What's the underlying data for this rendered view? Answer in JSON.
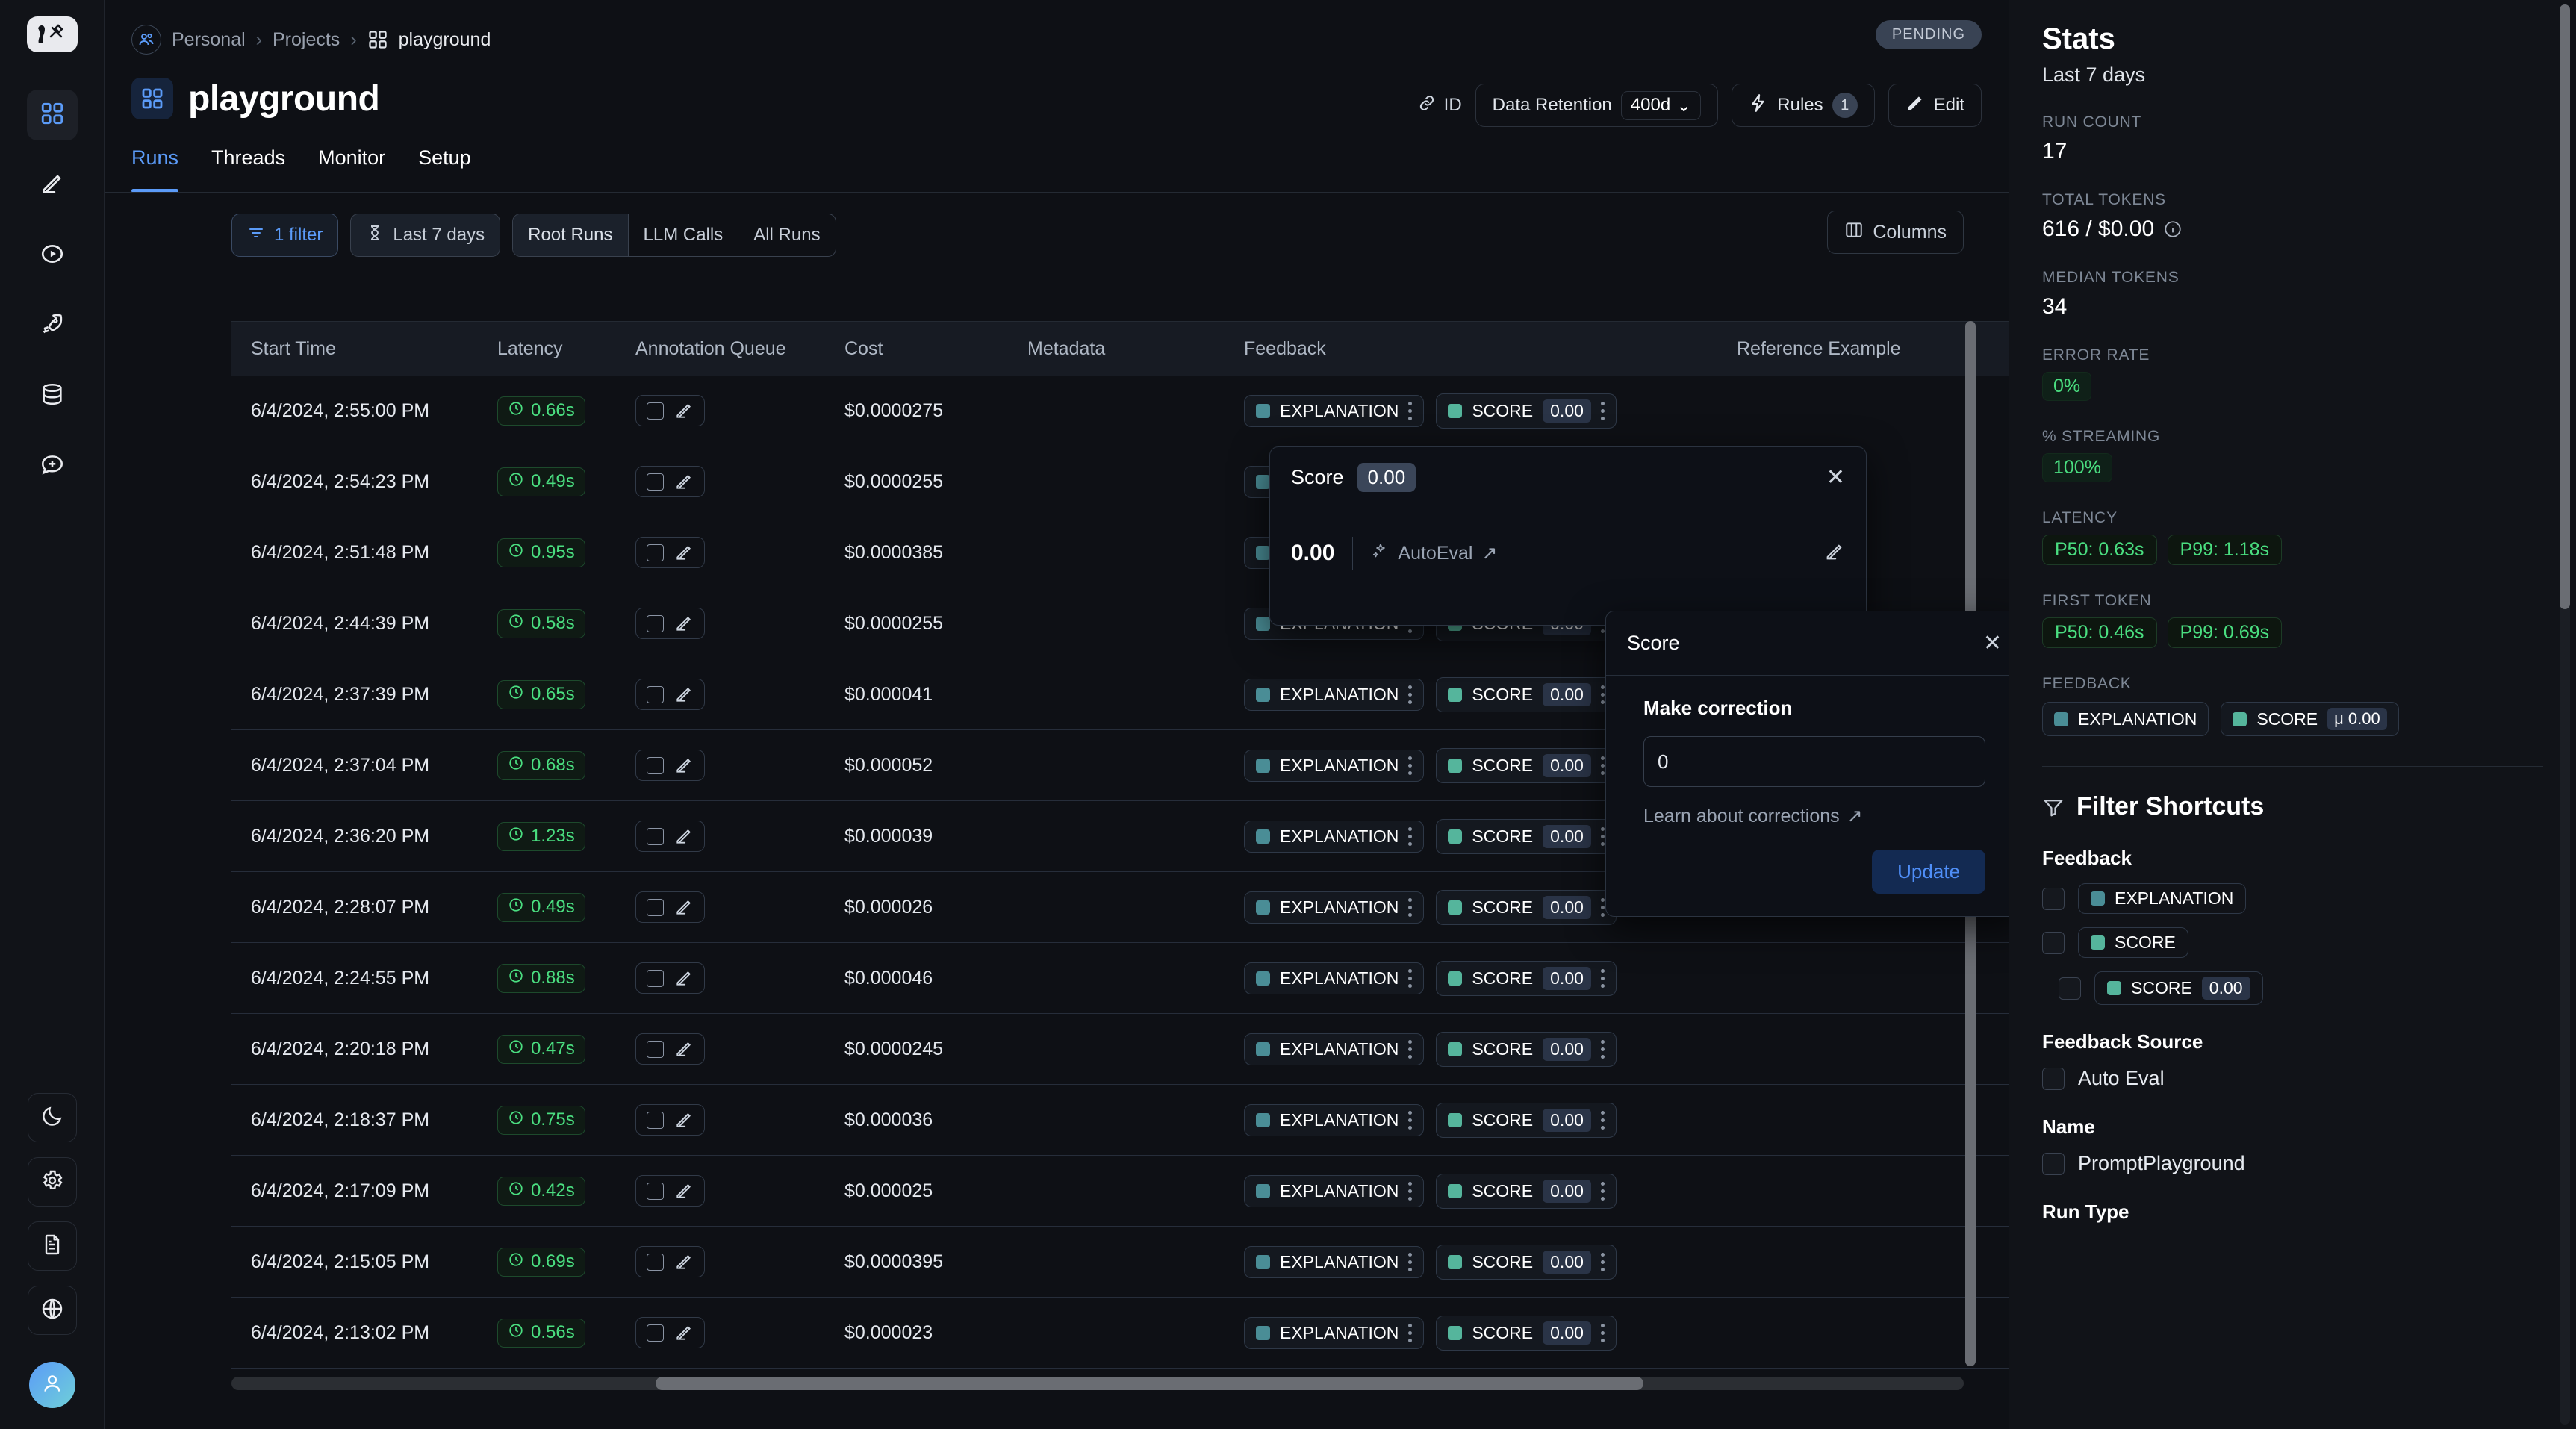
{
  "colors": {
    "accent": "#5b9bf8",
    "green": "#4ade80",
    "teal_explanation": "#4a8d96",
    "teal_score": "#55b59c",
    "panel_bg": "#111318",
    "page_bg": "#0e1015"
  },
  "left_rail": {
    "logo_name": "langsmith-logo",
    "top_items": [
      {
        "icon": "grid-icon",
        "name": "sidebar-item-projects",
        "active": true
      },
      {
        "icon": "pencil-icon",
        "name": "sidebar-item-prompts",
        "active": false
      },
      {
        "icon": "play-circle-icon",
        "name": "sidebar-item-playground",
        "active": false
      },
      {
        "icon": "rocket-icon",
        "name": "sidebar-item-deployments",
        "active": false
      },
      {
        "icon": "database-icon",
        "name": "sidebar-item-datasets",
        "active": false
      },
      {
        "icon": "chat-plus-icon",
        "name": "sidebar-item-annotation",
        "active": false
      }
    ],
    "bottom_items": [
      {
        "icon": "moon-icon",
        "name": "theme-toggle-button"
      },
      {
        "icon": "gear-icon",
        "name": "settings-button"
      },
      {
        "icon": "document-icon",
        "name": "docs-button"
      },
      {
        "icon": "globe-icon",
        "name": "language-button"
      }
    ],
    "avatar_icon": "user-avatar-icon"
  },
  "breadcrumb": {
    "org_icon": "people-icon",
    "items": [
      "Personal",
      "Projects",
      "playground"
    ],
    "separator": "›",
    "project_icon": "grid-icon"
  },
  "header": {
    "status_badge": "PENDING",
    "title": "playground",
    "title_icon": "grid-icon",
    "id_label": "ID",
    "id_icon": "link-icon",
    "data_retention_label": "Data Retention",
    "data_retention_value": "400d",
    "data_retention_caret": "⌄",
    "rules_label": "Rules",
    "rules_icon": "lightning-icon",
    "rules_count": "1",
    "edit_label": "Edit",
    "edit_icon": "pencil-icon"
  },
  "tabs": [
    {
      "label": "Runs",
      "active": true
    },
    {
      "label": "Threads",
      "active": false
    },
    {
      "label": "Monitor",
      "active": false
    },
    {
      "label": "Setup",
      "active": false
    }
  ],
  "toolbar": {
    "filter_label": "1 filter",
    "filter_icon": "filter-icon",
    "range_label": "Last 7 days",
    "range_icon": "hourglass-icon",
    "segments": [
      {
        "label": "Root Runs",
        "active": true
      },
      {
        "label": "LLM Calls",
        "active": false
      },
      {
        "label": "All Runs",
        "active": false
      }
    ],
    "columns_label": "Columns",
    "columns_icon": "columns-icon"
  },
  "table": {
    "headers": [
      "Start Time",
      "Latency",
      "Annotation Queue",
      "Cost",
      "Metadata",
      "Feedback",
      "Reference Example"
    ],
    "feedback_tags": {
      "explanation_label": "EXPLANATION",
      "score_label": "SCORE",
      "score_value": "0.00"
    },
    "rows": [
      {
        "start_time": "6/4/2024, 2:55:00 PM",
        "latency": "0.66s",
        "cost": "$0.0000275",
        "metadata": "",
        "reference_example": ""
      },
      {
        "start_time": "6/4/2024, 2:54:23 PM",
        "latency": "0.49s",
        "cost": "$0.0000255",
        "metadata": "",
        "reference_example": ""
      },
      {
        "start_time": "6/4/2024, 2:51:48 PM",
        "latency": "0.95s",
        "cost": "$0.0000385",
        "metadata": "",
        "reference_example": ""
      },
      {
        "start_time": "6/4/2024, 2:44:39 PM",
        "latency": "0.58s",
        "cost": "$0.0000255",
        "metadata": "",
        "reference_example": ""
      },
      {
        "start_time": "6/4/2024, 2:37:39 PM",
        "latency": "0.65s",
        "cost": "$0.000041",
        "metadata": "",
        "reference_example": ""
      },
      {
        "start_time": "6/4/2024, 2:37:04 PM",
        "latency": "0.68s",
        "cost": "$0.000052",
        "metadata": "",
        "reference_example": ""
      },
      {
        "start_time": "6/4/2024, 2:36:20 PM",
        "latency": "1.23s",
        "cost": "$0.000039",
        "metadata": "",
        "reference_example": ""
      },
      {
        "start_time": "6/4/2024, 2:28:07 PM",
        "latency": "0.49s",
        "cost": "$0.000026",
        "metadata": "",
        "reference_example": ""
      },
      {
        "start_time": "6/4/2024, 2:24:55 PM",
        "latency": "0.88s",
        "cost": "$0.000046",
        "metadata": "",
        "reference_example": ""
      },
      {
        "start_time": "6/4/2024, 2:20:18 PM",
        "latency": "0.47s",
        "cost": "$0.0000245",
        "metadata": "",
        "reference_example": ""
      },
      {
        "start_time": "6/4/2024, 2:18:37 PM",
        "latency": "0.75s",
        "cost": "$0.000036",
        "metadata": "",
        "reference_example": ""
      },
      {
        "start_time": "6/4/2024, 2:17:09 PM",
        "latency": "0.42s",
        "cost": "$0.000025",
        "metadata": "",
        "reference_example": ""
      },
      {
        "start_time": "6/4/2024, 2:15:05 PM",
        "latency": "0.69s",
        "cost": "$0.0000395",
        "metadata": "",
        "reference_example": ""
      },
      {
        "start_time": "6/4/2024, 2:13:02 PM",
        "latency": "0.56s",
        "cost": "$0.000023",
        "metadata": "",
        "reference_example": ""
      }
    ]
  },
  "score_popover": {
    "title": "Score",
    "badge_value": "0.00",
    "close_icon": "close-icon",
    "value": "0.00",
    "source": "AutoEval",
    "source_icon": "sparkle-icon",
    "external_icon": "↗",
    "edit_icon": "pencil-icon"
  },
  "correction_popover": {
    "title": "Score",
    "close_icon": "close-icon",
    "section_label": "Make correction",
    "input_value": "0",
    "input_placeholder": "0",
    "learn_link": "Learn about corrections",
    "learn_link_icon": "↗",
    "update_label": "Update"
  },
  "stats": {
    "title": "Stats",
    "subtitle": "Last 7 days",
    "run_count_label": "RUN COUNT",
    "run_count_value": "17",
    "total_tokens_label": "TOTAL TOKENS",
    "total_tokens_value": "616 / $0.00",
    "total_tokens_info_icon": "info-icon",
    "median_tokens_label": "MEDIAN TOKENS",
    "median_tokens_value": "34",
    "error_rate_label": "ERROR RATE",
    "error_rate_value": "0%",
    "streaming_label": "% STREAMING",
    "streaming_value": "100%",
    "latency_label": "LATENCY",
    "latency_p50": "P50: 0.63s",
    "latency_p99": "P99: 1.18s",
    "first_token_label": "FIRST TOKEN",
    "first_token_p50": "P50: 0.46s",
    "first_token_p99": "P99: 0.69s",
    "feedback_label": "FEEDBACK",
    "feedback_explanation": "EXPLANATION",
    "feedback_score": "SCORE",
    "feedback_score_mu": "μ 0.00"
  },
  "filter_shortcuts": {
    "title": "Filter Shortcuts",
    "title_icon": "funnel-icon",
    "groups": [
      {
        "label": "Feedback",
        "items": [
          {
            "type": "tag",
            "text": "EXPLANATION",
            "dot": "explanation",
            "indent": false
          },
          {
            "type": "tag",
            "text": "SCORE",
            "dot": "score",
            "indent": false
          },
          {
            "type": "tag",
            "text": "SCORE",
            "value": "0.00",
            "dot": "score",
            "indent": true
          }
        ]
      },
      {
        "label": "Feedback Source",
        "items": [
          {
            "type": "text",
            "text": "Auto Eval",
            "indent": false
          }
        ]
      },
      {
        "label": "Name",
        "items": [
          {
            "type": "text",
            "text": "PromptPlayground",
            "indent": false
          }
        ]
      },
      {
        "label": "Run Type",
        "items": []
      }
    ]
  }
}
